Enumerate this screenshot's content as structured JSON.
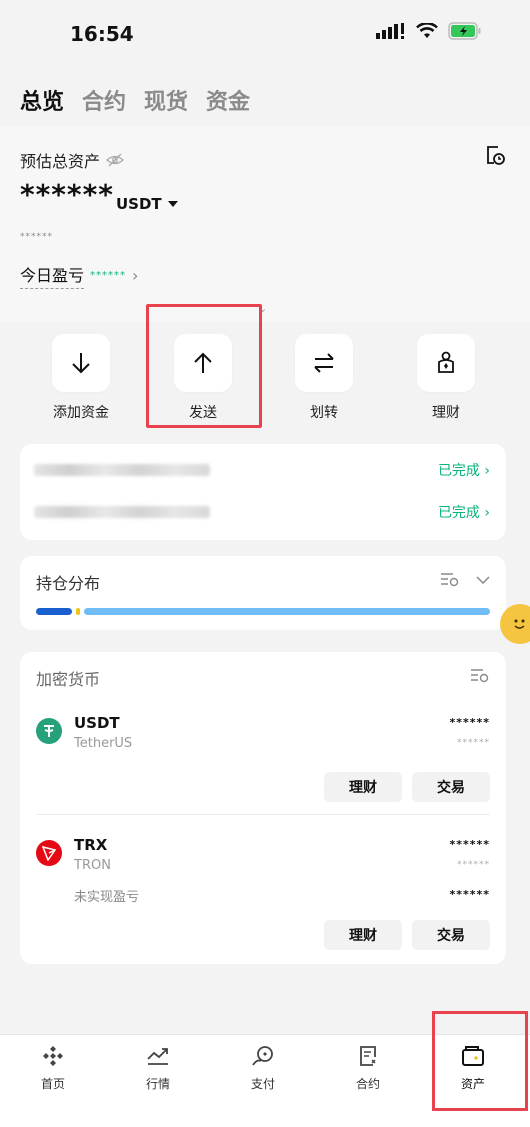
{
  "status": {
    "time": "16:54"
  },
  "tabs": [
    {
      "label": "总览",
      "active": true
    },
    {
      "label": "合约",
      "active": false
    },
    {
      "label": "现货",
      "active": false
    },
    {
      "label": "资金",
      "active": false
    }
  ],
  "header": {
    "asset_label": "预估总资产",
    "asset_value": "******",
    "asset_unit": "USDT",
    "asset_sub": "******",
    "pnl_label": "今日盈亏",
    "pnl_value": "******"
  },
  "actions": [
    {
      "label": "添加资金",
      "icon": "arrow-down-icon"
    },
    {
      "label": "发送",
      "icon": "arrow-up-icon"
    },
    {
      "label": "划转",
      "icon": "transfer-icon"
    },
    {
      "label": "理财",
      "icon": "earn-icon"
    }
  ],
  "tasks": [
    {
      "status": "已完成"
    },
    {
      "status": "已完成"
    }
  ],
  "distribution": {
    "title": "持仓分布",
    "colors": [
      "#1a5fd0",
      "#f0c419",
      "#6fbdf4"
    ]
  },
  "coins": {
    "title": "加密货币",
    "items": [
      {
        "symbol": "USDT",
        "name": "TetherUS",
        "value": "******",
        "subvalue": "******",
        "color": "#26a17b"
      },
      {
        "symbol": "TRX",
        "name": "TRON",
        "value": "******",
        "subvalue": "******",
        "extra_label": "未实现盈亏",
        "extra_value": "******",
        "color": "#e50915"
      }
    ],
    "btn_earn": "理财",
    "btn_trade": "交易"
  },
  "nav": [
    {
      "label": "首页",
      "icon": "binance-logo-icon"
    },
    {
      "label": "行情",
      "icon": "chart-icon"
    },
    {
      "label": "支付",
      "icon": "pay-icon"
    },
    {
      "label": "合约",
      "icon": "futures-icon"
    },
    {
      "label": "资产",
      "icon": "wallet-icon",
      "active": true
    }
  ]
}
